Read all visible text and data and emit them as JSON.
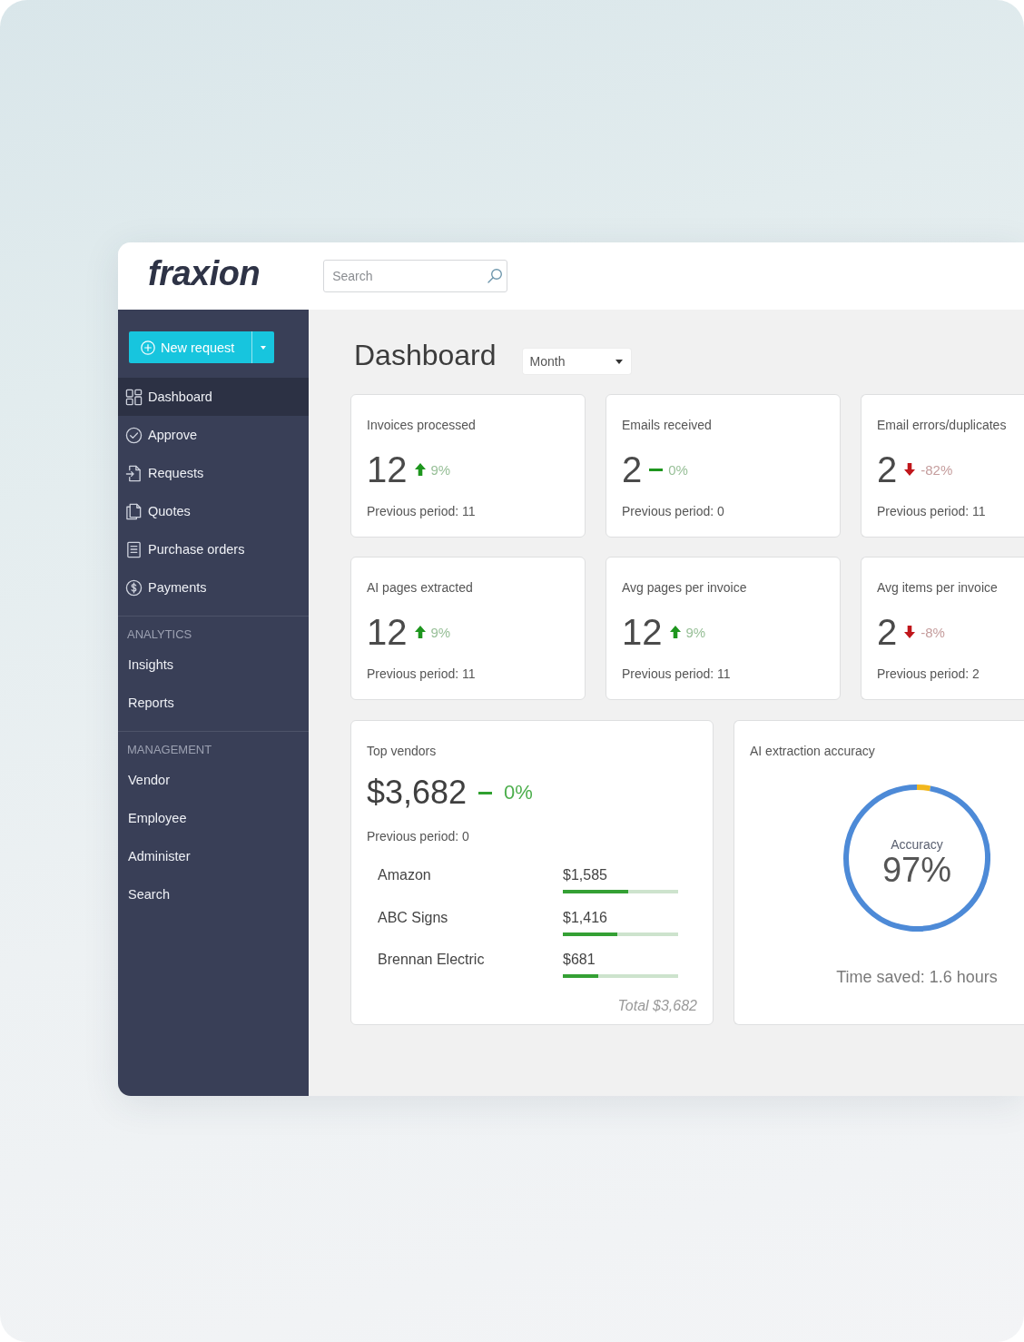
{
  "header": {
    "logo": "fraxion",
    "search": {
      "placeholder": "Search"
    }
  },
  "sidebar": {
    "new_request": {
      "label": "New request"
    },
    "sections": [
      {
        "items": [
          {
            "label": "Dashboard",
            "selected": true
          },
          {
            "label": "Approve",
            "selected": false
          },
          {
            "label": "Requests",
            "selected": false
          },
          {
            "label": "Quotes",
            "selected": false
          },
          {
            "label": "Purchase orders",
            "selected": false
          },
          {
            "label": "Payments",
            "selected": false
          }
        ]
      },
      {
        "heading": "ANALYTICS",
        "items": [
          {
            "label": "Insights",
            "selected": false
          },
          {
            "label": "Reports",
            "selected": false
          }
        ]
      },
      {
        "heading": "MANAGEMENT",
        "items": [
          {
            "label": "Vendor",
            "selected": false
          },
          {
            "label": "Employee",
            "selected": false
          },
          {
            "label": "Administer",
            "selected": false
          },
          {
            "label": "Search",
            "selected": false
          }
        ]
      }
    ]
  },
  "page": {
    "title": "Dashboard",
    "period": {
      "value": "Month"
    }
  },
  "stats": [
    {
      "title": "Invoices processed",
      "value": "12",
      "change": {
        "kind": "up",
        "text": "9%"
      },
      "previous": "Previous period: 11"
    },
    {
      "title": "Emails received",
      "value": "2",
      "change": {
        "kind": "flat",
        "text": "0%"
      },
      "previous": "Previous period: 0"
    },
    {
      "title": "Email errors/duplicates",
      "value": "2",
      "change": {
        "kind": "down",
        "text": "-82%"
      },
      "previous": "Previous period: 11"
    },
    {
      "title": "AI pages extracted",
      "value": "12",
      "change": {
        "kind": "up",
        "text": "9%"
      },
      "previous": "Previous period: 11"
    },
    {
      "title": "Avg pages per invoice",
      "value": "12",
      "change": {
        "kind": "up",
        "text": "9%"
      },
      "previous": "Previous period: 11"
    },
    {
      "title": "Avg items per invoice",
      "value": "2",
      "change": {
        "kind": "down",
        "text": "-8%"
      },
      "previous": "Previous period: 2"
    }
  ],
  "top_vendors": {
    "title": "Top vendors",
    "total": "$3,682",
    "change": {
      "kind": "flat",
      "text": "0%"
    },
    "previous": "Previous period: 0",
    "vendors": [
      {
        "name": "Amazon",
        "amount": "$1,585",
        "level": 0.57
      },
      {
        "name": "ABC Signs",
        "amount": "$1,416",
        "level": 0.47
      },
      {
        "name": "Brennan Electric",
        "amount": "$681",
        "level": 0.31
      }
    ],
    "footer": "Total $3,682"
  },
  "accuracy": {
    "title": "AI extraction accuracy",
    "label": "Accuracy",
    "value": "97%",
    "level": 0.97,
    "time_saved": "Time saved: 1.6 hours"
  }
}
